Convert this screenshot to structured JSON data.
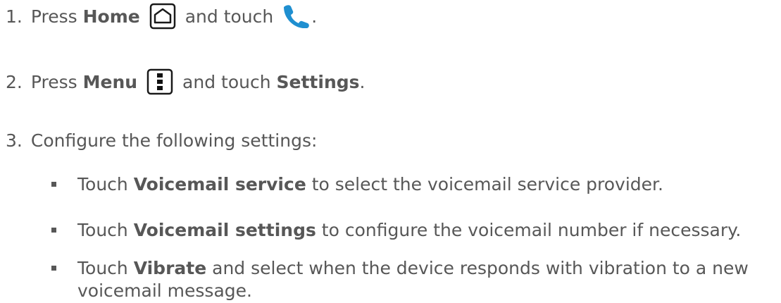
{
  "steps": [
    {
      "number": "1.",
      "pre": "Press ",
      "key": "Home",
      "key_icon": "home-key-icon",
      "mid": "and touch",
      "extra_icon": "phone-icon",
      "end": "."
    },
    {
      "number": "2.",
      "pre": "Press ",
      "key": "Menu",
      "key_icon": "menu-key-icon",
      "mid": "and touch ",
      "target": "Settings",
      "end": "."
    },
    {
      "number": "3.",
      "text": "Configure the following settings:"
    }
  ],
  "bullets": [
    {
      "pre": "Touch ",
      "bold": "Voicemail service",
      "post": " to select the voicemail service provider."
    },
    {
      "pre": "Touch ",
      "bold": "Voicemail settings",
      "post": " to configure the voicemail number if necessary."
    },
    {
      "pre": "Touch ",
      "bold": "Vibrate",
      "post": " and select when the device responds with vibration to a new voicemail message."
    }
  ],
  "colors": {
    "text": "#575757",
    "icon_stroke": "#1a1a1a",
    "phone_blue": "#1f8fd0"
  }
}
